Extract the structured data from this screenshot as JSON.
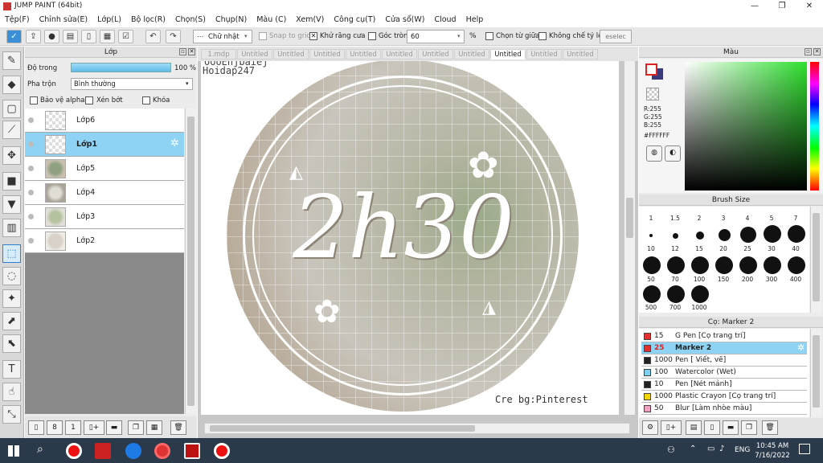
{
  "app": {
    "title": "JUMP PAINT (64bit)"
  },
  "menu": [
    "Tệp(F)",
    "Chỉnh sửa(E)",
    "Lớp(L)",
    "Bộ lọc(R)",
    "Chọn(S)",
    "Chụp(N)",
    "Màu (C)",
    "Xem(V)",
    "Công cụ(T)",
    "Cửa sổ(W)",
    "Cloud",
    "Help"
  ],
  "toolbar": {
    "shape": "Chữ nhật",
    "snap": "Snap to grid",
    "antialias": "Khử răng cưa",
    "corner": "Góc tròn",
    "corner_value": "60",
    "percent": "%",
    "select_center": "Chọn từ giữa",
    "no_ratio": "Không chế tỷ lệ",
    "deselect": "eselec"
  },
  "layer_panel": {
    "title": "Lớp",
    "opacity_label": "Độ trong",
    "opacity_value": "100 %",
    "blend_label": "Pha trộn",
    "blend_value": "Bình thường",
    "protect_alpha": "Bảo vệ alpha",
    "clip": "Xén bớt",
    "lock": "Khóa",
    "layers": [
      {
        "name": "Lớp6"
      },
      {
        "name": "Lớp1"
      },
      {
        "name": "Lớp5"
      },
      {
        "name": "Lớp4"
      },
      {
        "name": "Lớp3"
      },
      {
        "name": "Lớp2"
      }
    ]
  },
  "tabs": [
    "1.mdp",
    "Untitled",
    "Untitled",
    "Untitled",
    "Untitled",
    "Untitled",
    "Untitled",
    "Untitled",
    "Untitled",
    "Untitled",
    "Untitled"
  ],
  "active_tab": "Untitled",
  "canvas": {
    "header_text": "Hoidap247",
    "cut_text": "oooEhjbaiej",
    "main_text": "2h30",
    "credit": "Cre bg:Pinterest"
  },
  "color_panel": {
    "title": "Màu",
    "r": "R:255",
    "g": "G:255",
    "b": "B:255",
    "hex": "#FFFFFF"
  },
  "brush_size": {
    "title": "Brush Size",
    "sizes": [
      "1",
      "1.5",
      "2",
      "3",
      "4",
      "5",
      "7",
      "10",
      "12",
      "15",
      "20",
      "25",
      "30",
      "40",
      "50",
      "70",
      "100",
      "150",
      "200",
      "300",
      "400",
      "500",
      "700",
      "1000"
    ]
  },
  "brush_panel": {
    "title": "Cọ: Marker 2",
    "brushes": [
      {
        "size": "15",
        "name": "G Pen [Cọ trang trí]",
        "color": "#e03030"
      },
      {
        "size": "25",
        "name": "Marker 2",
        "color": "#e03030"
      },
      {
        "size": "1000",
        "name": "Pen [ Viết, vẽ]",
        "color": "#222222"
      },
      {
        "size": "100",
        "name": "Watercolor (Wet)",
        "color": "#7fd0ef"
      },
      {
        "size": "10",
        "name": "Pen [Nét mảnh]",
        "color": "#222222"
      },
      {
        "size": "1000",
        "name": "Plastic Crayon [Cọ trang trí]",
        "color": "#f2d400"
      },
      {
        "size": "50",
        "name": "Blur [Làm nhòe màu]",
        "color": "#f0a0c0"
      }
    ]
  },
  "taskbar": {
    "lang": "ENG",
    "time": "10:45 AM",
    "date": "7/16/2022"
  },
  "colors": {
    "accent": "#99d9f7",
    "selected_layer": "#8fd3f4"
  }
}
